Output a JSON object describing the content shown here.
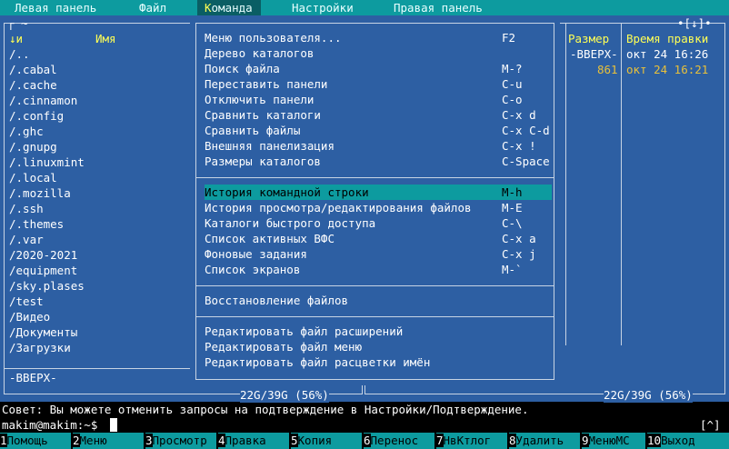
{
  "menubar": {
    "items": [
      "Левая панель",
      "Файл",
      "Команда",
      "Настройки",
      "Правая панель"
    ],
    "active_hotkey": "К",
    "active_rest": "оманда"
  },
  "left_panel": {
    "path_marker": "~",
    "col_sort": "↓и",
    "col_name": "Имя",
    "files": [
      "/..",
      "/.cabal",
      "/.cache",
      "/.cinnamon",
      "/.config",
      "/.ghc",
      "/.gnupg",
      "/.linuxmint",
      "/.local",
      "/.mozilla",
      "/.ssh",
      "/.themes",
      "/.var",
      "/2020-2021",
      "/equipment",
      "/sky.plases",
      "/test",
      "/Видео",
      "/Документы",
      "/Загрузки"
    ],
    "status": "-ВВЕРХ-",
    "disk": "22G/39G (56%)"
  },
  "right_panel": {
    "corner": "•[↓]•",
    "col_size": "Размер",
    "col_time": "Время правки",
    "rows": [
      {
        "size": "-ВВЕРХ-",
        "time": "окт 24 16:26"
      },
      {
        "size": "861",
        "time": "окт 24 16:21"
      }
    ],
    "disk": "22G/39G (56%)"
  },
  "dropdown": {
    "items": [
      {
        "label": "Меню пользователя...",
        "key": "F2"
      },
      {
        "label": "Дерево каталогов",
        "key": ""
      },
      {
        "label": "Поиск файла",
        "key": "M-?"
      },
      {
        "label": "Переставить панели",
        "key": "C-u"
      },
      {
        "label": "Отключить панели",
        "key": "C-o"
      },
      {
        "label": "Сравнить каталоги",
        "key": "C-x d"
      },
      {
        "label": "Сравнить файлы",
        "key": "C-x C-d"
      },
      {
        "label": "Внешняя панелизация",
        "key": "C-x !"
      },
      {
        "label": "Размеры каталогов",
        "key": "C-Space"
      },
      {
        "label": "История командной строки",
        "key": "M-h"
      },
      {
        "label": "История просмотра/редактирования файлов",
        "key": "M-E"
      },
      {
        "label": "Каталоги быстрого доступа",
        "key": "C-\\"
      },
      {
        "label": "Список активных ВФС",
        "key": "C-x a"
      },
      {
        "label": "Фоновые задания",
        "key": "C-x j"
      },
      {
        "label": "Список экранов",
        "key": "M-`"
      },
      {
        "label": "Восстановление файлов",
        "key": ""
      },
      {
        "label": "Редактировать файл расширений",
        "key": ""
      },
      {
        "label": "Редактировать файл меню",
        "key": ""
      },
      {
        "label": "Редактировать файл расцветки имён",
        "key": ""
      }
    ]
  },
  "hint": "Совет: Вы можете отменить запросы на подтверждение в Настройки/Подтверждение.",
  "prompt": "makim@makim:~$",
  "scroll_marker": "[^]",
  "fkeys": [
    {
      "n": "1",
      "label": "Помощь"
    },
    {
      "n": "2",
      "label": "Меню"
    },
    {
      "n": "3",
      "label": "Просмотр"
    },
    {
      "n": "4",
      "label": "Правка"
    },
    {
      "n": "5",
      "label": "Копия"
    },
    {
      "n": "6",
      "label": "Перенос"
    },
    {
      "n": "7",
      "label": "НвКтлог"
    },
    {
      "n": "8",
      "label": "Удалить"
    },
    {
      "n": "9",
      "label": "МенюMC"
    },
    {
      "n": "10",
      "label": "Выход"
    }
  ],
  "colors": {
    "panel": "#2d5fa3",
    "menubar": "#0d9b9f",
    "highlight": "#ffff55"
  }
}
